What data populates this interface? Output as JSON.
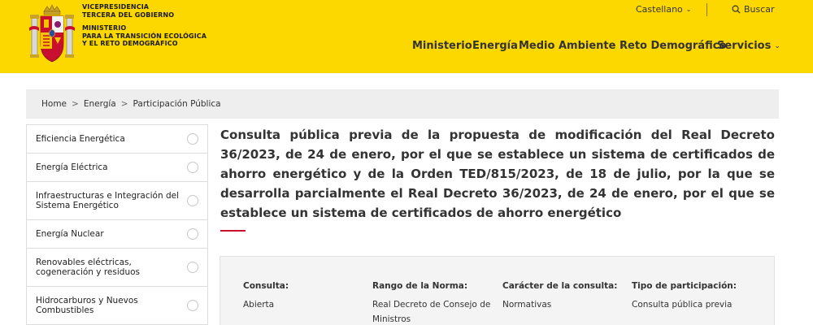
{
  "header": {
    "org_lines_1": [
      "VICEPRESIDENCIA",
      "TERCERA DEL GOBIERNO"
    ],
    "org_lines_2": [
      "MINISTERIO",
      "PARA LA TRANSICIÓN ECOLÓGICA",
      "Y EL RETO DEMOGRÁFICO"
    ],
    "language": "Castellano",
    "search_label": "Buscar",
    "nav": [
      {
        "label": "Ministerio",
        "dropdown": false
      },
      {
        "label": "Energía",
        "dropdown": false
      },
      {
        "label": "Medio Ambiente",
        "dropdown": true
      },
      {
        "label": "Reto Demográfico",
        "dropdown": false
      },
      {
        "label": "Servicios",
        "dropdown": true
      }
    ],
    "colors": {
      "brand_yellow": "#fdd800",
      "accent_red": "#c8102e"
    }
  },
  "breadcrumb": [
    "Home",
    "Energía",
    "Participación Pública"
  ],
  "sidebar": {
    "items": [
      {
        "label": "Eficiencia Energética"
      },
      {
        "label": "Energía Eléctrica"
      },
      {
        "label": "Infraestructuras e Integración del Sistema Energético"
      },
      {
        "label": "Energía Nuclear"
      },
      {
        "label": "Renovables eléctricas, cogeneración y residuos"
      },
      {
        "label": "Hidrocarburos y Nuevos Combustibles"
      }
    ]
  },
  "main": {
    "title": "Consulta pública previa de la propuesta de modificación del Real Decreto 36/2023, de 24 de enero, por el que se establece un sistema de certificados de ahorro energético y de la Orden TED/815/2023, de 18 de julio, por la que se desarrolla parcialmente el Real Decreto 36/2023, de 24 de enero, por el que se establece un sistema de certificados de ahorro energético",
    "info": [
      {
        "label": "Consulta:",
        "value": "Abierta"
      },
      {
        "label": "Rango de la Norma:",
        "value": "Real Decreto de Consejo de Ministros"
      },
      {
        "label": "Carácter de la consulta:",
        "value": "Normativas"
      },
      {
        "label": "Tipo de participación:",
        "value": "Consulta pública previa"
      }
    ]
  }
}
